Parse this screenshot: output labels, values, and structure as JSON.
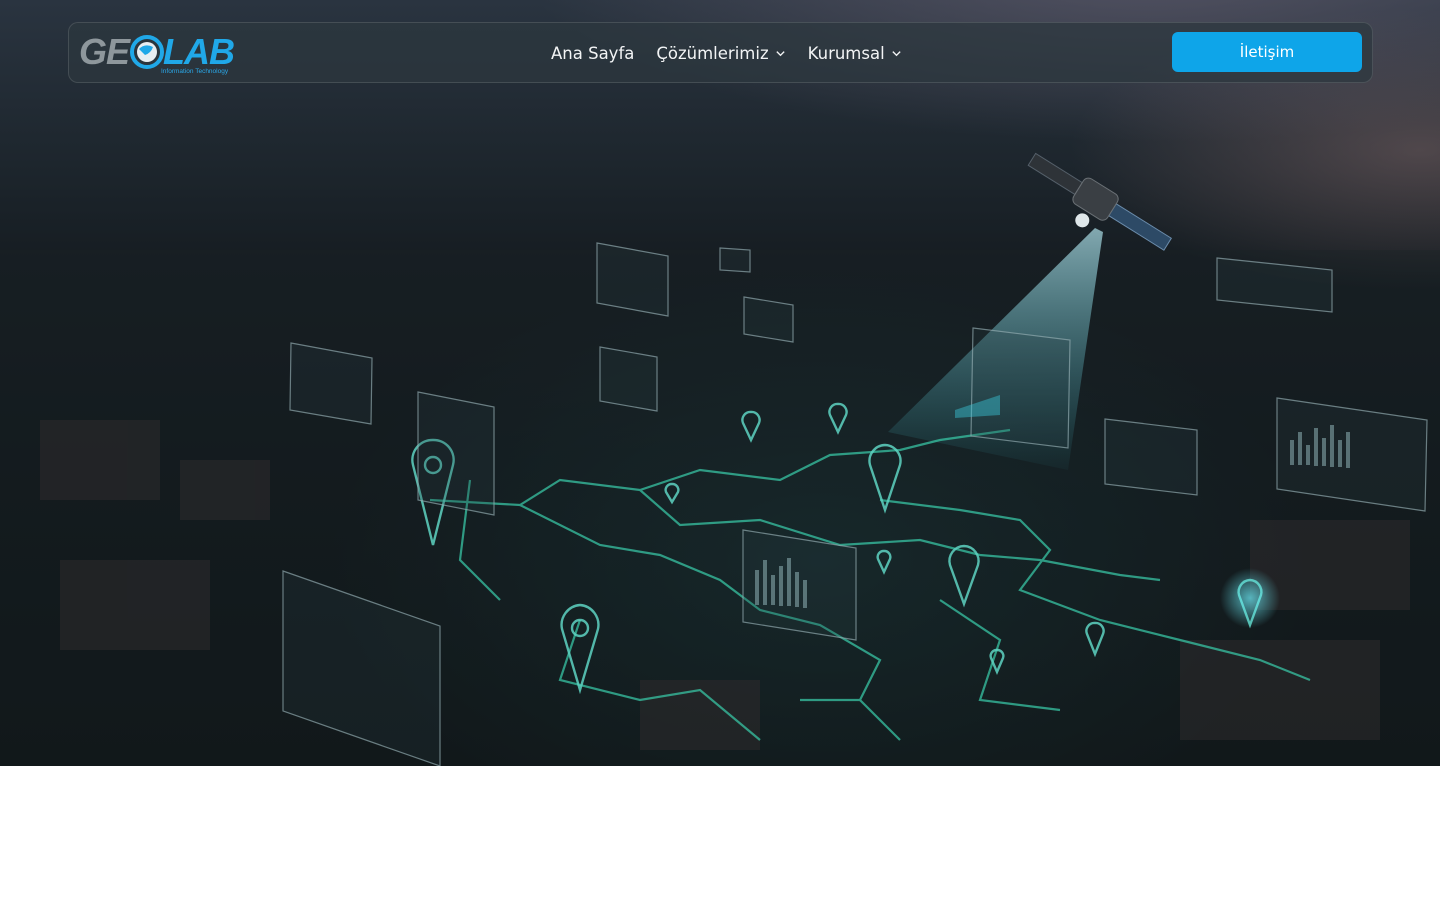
{
  "brand": {
    "logo_text_left": "GE",
    "logo_text_right": "LAB",
    "tagline": "Information Technology",
    "colors": {
      "grey": "#8e979c",
      "blue": "#20a8e8"
    }
  },
  "nav": {
    "items": [
      {
        "label": "Ana Sayfa",
        "has_dropdown": false
      },
      {
        "label": "Çözümlerimiz",
        "has_dropdown": true
      },
      {
        "label": "Kurumsal",
        "has_dropdown": true
      }
    ],
    "cta_label": "İletişim",
    "cta_color": "#0ea5e9"
  },
  "hero": {
    "image_description_icon": "satellite-city-map-illustration"
  }
}
